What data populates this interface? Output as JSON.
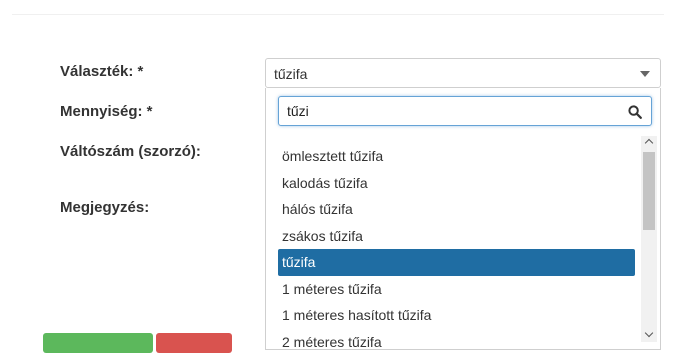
{
  "form": {
    "labels": {
      "valasztek": "Választék: *",
      "mennyiseg": "Mennyiség: *",
      "valtoszam": "Váltószám (szorzó):",
      "megjegyzes": "Megjegyzés:"
    }
  },
  "select": {
    "value": "tűzifa",
    "icon": "chevron-down-icon"
  },
  "dropdown": {
    "search_value": "tűzi",
    "search_icon": "search-icon",
    "selected_index": 4,
    "items": [
      {
        "label": "ömlesztett tűzifa"
      },
      {
        "label": "kalodás tűzifa"
      },
      {
        "label": "hálós tűzifa"
      },
      {
        "label": "zsákos tűzifa"
      },
      {
        "label": "tűzifa"
      },
      {
        "label": "1 méteres tűzifa"
      },
      {
        "label": "1 méteres hasított tűzifa"
      },
      {
        "label": "2 méteres tűzifa"
      }
    ]
  },
  "colors": {
    "selected_bg": "#1f6da3",
    "focus_border": "#66a3d6",
    "save_button": "#5cb85c",
    "cancel_button": "#d9534f"
  }
}
